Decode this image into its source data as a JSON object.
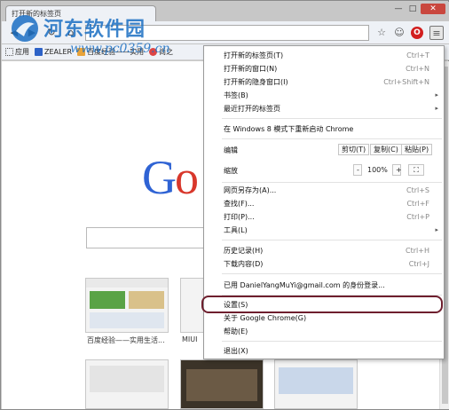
{
  "browser": {
    "tab_title": "打开新的标签页",
    "omnibox_placeholder": "",
    "window_controls": {
      "minimize": "—",
      "maximize": "□",
      "close": "✕"
    }
  },
  "watermark": {
    "title": "河东软件园",
    "url": "www.pc0359.cn"
  },
  "bookmarks": [
    {
      "label": "应用",
      "icon": "apps-icon"
    },
    {
      "label": "ZEALER",
      "icon": "zealer-icon"
    },
    {
      "label": "百度经验——实用",
      "icon": "baidu-icon"
    },
    {
      "label": "尚之",
      "icon": "weibo-icon"
    }
  ],
  "page": {
    "google_text": "Go",
    "thumbnails": [
      {
        "caption": "百度经验——实用生活..."
      },
      {
        "caption": "MIUI"
      }
    ]
  },
  "menu": {
    "items": [
      {
        "label": "打开新的标签页(T)",
        "shortcut": "Ctrl+T",
        "arrow": ""
      },
      {
        "label": "打开新的窗口(N)",
        "shortcut": "Ctrl+N",
        "arrow": ""
      },
      {
        "label": "打开新的隐身窗口(I)",
        "shortcut": "Ctrl+Shift+N",
        "arrow": ""
      },
      {
        "label": "书签(B)",
        "shortcut": "",
        "arrow": "▸"
      },
      {
        "label": "最近打开的标签页",
        "shortcut": "",
        "arrow": "▸"
      },
      {
        "label": "在 Windows 8 模式下重新启动 Chrome",
        "shortcut": "",
        "arrow": ""
      },
      {
        "label": "编辑",
        "shortcut": "",
        "arrow": ""
      },
      {
        "label": "缩放",
        "shortcut": "",
        "arrow": ""
      },
      {
        "label": "网页另存为(A)...",
        "shortcut": "Ctrl+S",
        "arrow": ""
      },
      {
        "label": "查找(F)...",
        "shortcut": "Ctrl+F",
        "arrow": ""
      },
      {
        "label": "打印(P)...",
        "shortcut": "Ctrl+P",
        "arrow": ""
      },
      {
        "label": "工具(L)",
        "shortcut": "",
        "arrow": "▸"
      },
      {
        "label": "历史记录(H)",
        "shortcut": "Ctrl+H",
        "arrow": ""
      },
      {
        "label": "下载内容(D)",
        "shortcut": "Ctrl+J",
        "arrow": ""
      },
      {
        "label": "已用 DanielYangMuYi@gmail.com 的身份登录...",
        "shortcut": "",
        "arrow": ""
      },
      {
        "label": "设置(S)",
        "shortcut": "",
        "arrow": ""
      },
      {
        "label": "关于 Google Chrome(G)",
        "shortcut": "",
        "arrow": ""
      },
      {
        "label": "帮助(E)",
        "shortcut": "",
        "arrow": ""
      },
      {
        "label": "退出(X)",
        "shortcut": "",
        "arrow": ""
      }
    ],
    "edit_buttons": {
      "cut": "剪切(T)",
      "copy": "复制(C)",
      "paste": "粘贴(P)"
    },
    "zoom": {
      "minus": "-",
      "level": "100%",
      "plus": "+",
      "fullscreen": "⛶"
    }
  },
  "colors": {
    "highlight_border": "#6e1f2e",
    "google_blue": "#2f63d4",
    "google_red": "#d8372b"
  }
}
